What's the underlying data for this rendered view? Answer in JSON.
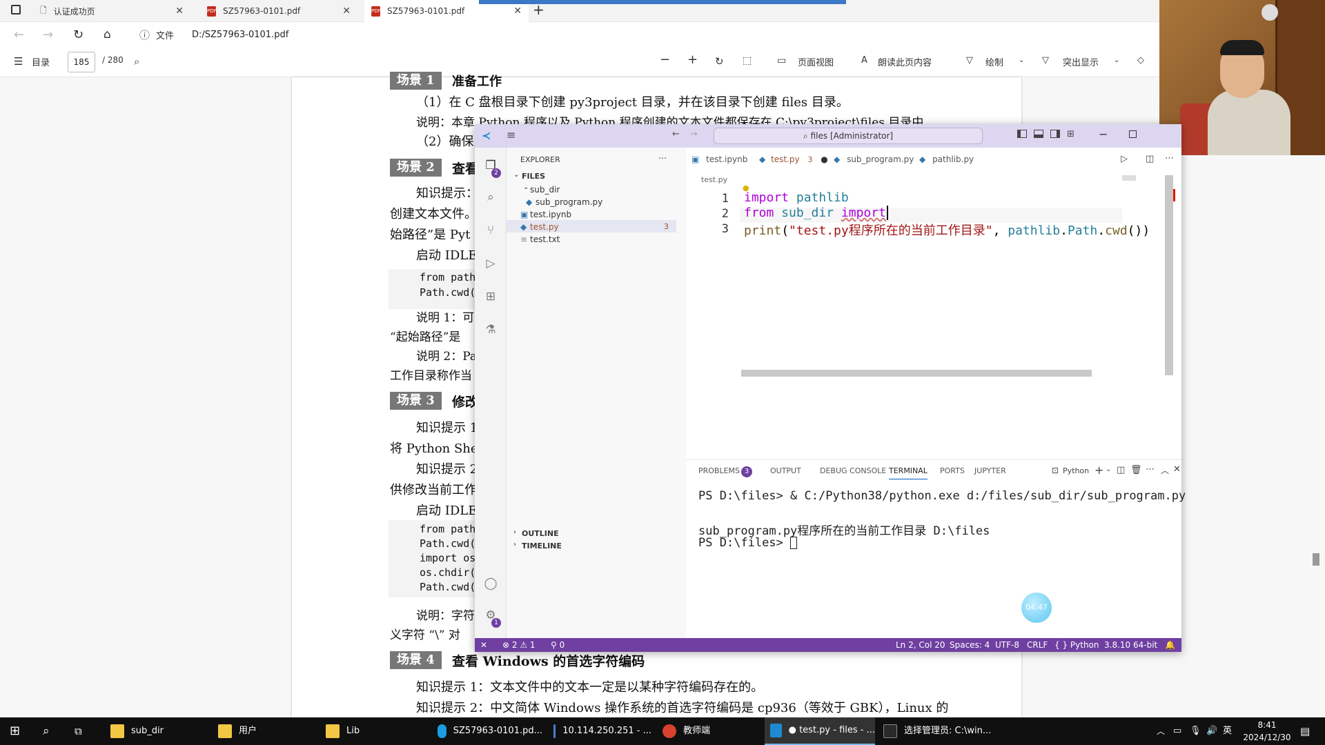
{
  "browser": {
    "tabs": [
      {
        "title": "认证成功页"
      },
      {
        "title": "SZ57963-0101.pdf"
      },
      {
        "title": "SZ57963-0101.pdf"
      }
    ],
    "address": {
      "label": "文件",
      "url": "D:/SZ57963-0101.pdf"
    },
    "pdf_toolbar": {
      "toc": "目录",
      "page_current": "185",
      "page_total": "/ 280",
      "page_view": "页面视图",
      "read_aloud": "朗读此页内容",
      "draw": "绘制",
      "highlight": "突出显示"
    }
  },
  "pdf_page": {
    "scene1_label": "场景 1",
    "scene1_title": "准备工作",
    "s1_line1": "（1）在 C 盘根目录下创建 py3project 目录，并在该目录下创建 files 目录。",
    "s1_line2": "说明：本章 Python 程序以及 Python 程序创建的文本文件都保存在 C:\\py3project\\files 目录中",
    "s1_line3": "（2）确保里",
    "scene2_label": "场景 2",
    "scene2_title": "查看",
    "s2_line1": "知识提示：",
    "s2_line2": "创建文本文件。",
    "s2_line3": "始路径”是 Pyt",
    "s2_line4": "启动 IDLE",
    "s2_code1": "from path",
    "s2_code2": "Path.cwd(",
    "s2_note1": "说明 1：可",
    "s2_note2": "“起始路径”是",
    "s2_note3": "说明 2：Pa",
    "s2_note4": "工作目录称作当",
    "scene3_label": "场景 3",
    "scene3_title": "修改",
    "s3_line1": "知识提示 1",
    "s3_line2": "将 Python Shell",
    "s3_line3": "知识提示 2",
    "s3_line4": "供修改当前工作",
    "s3_line5": "启动 IDLE",
    "s3_code1": "from path",
    "s3_code2": "Path.cwd(",
    "s3_code3": "import os",
    "s3_code4": "os.chdir(",
    "s3_code5": "Path.cwd(",
    "s3_note1": "说明：字符",
    "s3_note2": "义字符 “\\” 对",
    "scene4_label": "场景 4",
    "scene4_title": "查看 Windows 的首选字符编码",
    "s4_line1": "知识提示 1：文本文件中的文本一定是以某种字符编码存在的。",
    "s4_line2": "知识提示 2：中文简体 Windows 操作系统的首选字符编码是 cp936（等效于 GBK），Linux 的"
  },
  "vscode": {
    "title_search": "files [Administrator]",
    "sidebar": {
      "header": "EXPLORER",
      "section": "FILES",
      "items": [
        {
          "name": "sub_dir"
        },
        {
          "name": "sub_program.py"
        },
        {
          "name": "test.ipynb"
        },
        {
          "name": "test.py",
          "badge": "3"
        },
        {
          "name": "test.txt"
        }
      ],
      "outline": "OUTLINE",
      "timeline": "TIMELINE",
      "explorer_badge": "2",
      "settings_badge": "1"
    },
    "tabs": [
      {
        "label": "test.ipynb"
      },
      {
        "label": "test.py",
        "badge": "3"
      },
      {
        "label": "sub_program.py"
      },
      {
        "label": "pathlib.py"
      }
    ],
    "breadcrumb": "test.py",
    "code_lines": [
      {
        "num": "1",
        "text": "import pathlib"
      },
      {
        "num": "2",
        "text": "from sub_dir import"
      },
      {
        "num": "3",
        "text": "print(\"test.py程序所在的当前工作目录\", pathlib.Path.cwd())"
      }
    ],
    "panel": {
      "tabs": [
        "PROBLEMS",
        "OUTPUT",
        "DEBUG CONSOLE",
        "TERMINAL",
        "PORTS",
        "JUPYTER"
      ],
      "problems_count": "3",
      "terminal_kind": "Python",
      "terminal_lines": [
        "PS D:\\files> & C:/Python38/python.exe d:/files/sub_dir/sub_program.py",
        "sub_program.py程序所在的当前工作目录 D:\\files",
        "PS D:\\files> "
      ],
      "timer": "04:47"
    },
    "status": {
      "errors": "2",
      "warnings": "1",
      "ports": "0",
      "position": "Ln 2, Col 20",
      "spaces": "Spaces: 4",
      "encoding": "UTF-8",
      "eol": "CRLF",
      "language": "Python",
      "interpreter": "3.8.10 64-bit"
    }
  },
  "taskbar": {
    "items": [
      {
        "label": "sub_dir"
      },
      {
        "label": "用户"
      },
      {
        "label": "Lib"
      },
      {
        "label": "SZ57963-0101.pd..."
      },
      {
        "label": "10.114.250.251 - ..."
      },
      {
        "label": "教师端"
      },
      {
        "label": "● test.py - files - ..."
      },
      {
        "label": "选择管理员: C:\\win..."
      }
    ],
    "ime": "英",
    "time": "8:41",
    "date": "2024/12/30"
  },
  "colors": {
    "vscode_title": "#ddd6f0",
    "vscode_status": "#6f3fa1",
    "keyword": "#af00db",
    "string": "#a31515",
    "accent_blue": "#005fb8"
  }
}
